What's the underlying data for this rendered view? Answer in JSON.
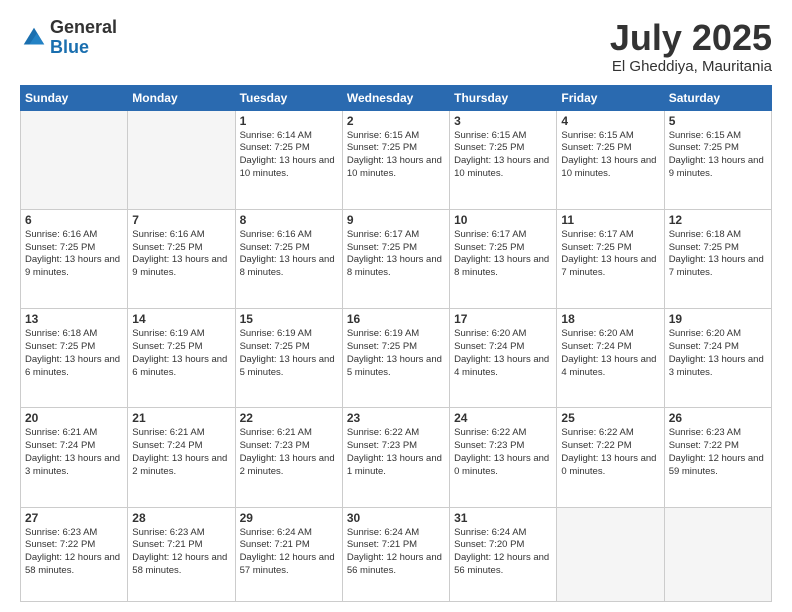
{
  "header": {
    "logo_line1": "General",
    "logo_line2": "Blue",
    "month": "July 2025",
    "location": "El Gheddiya, Mauritania"
  },
  "days_of_week": [
    "Sunday",
    "Monday",
    "Tuesday",
    "Wednesday",
    "Thursday",
    "Friday",
    "Saturday"
  ],
  "weeks": [
    [
      {
        "day": "",
        "info": ""
      },
      {
        "day": "",
        "info": ""
      },
      {
        "day": "1",
        "info": "Sunrise: 6:14 AM\nSunset: 7:25 PM\nDaylight: 13 hours\nand 10 minutes."
      },
      {
        "day": "2",
        "info": "Sunrise: 6:15 AM\nSunset: 7:25 PM\nDaylight: 13 hours\nand 10 minutes."
      },
      {
        "day": "3",
        "info": "Sunrise: 6:15 AM\nSunset: 7:25 PM\nDaylight: 13 hours\nand 10 minutes."
      },
      {
        "day": "4",
        "info": "Sunrise: 6:15 AM\nSunset: 7:25 PM\nDaylight: 13 hours\nand 10 minutes."
      },
      {
        "day": "5",
        "info": "Sunrise: 6:15 AM\nSunset: 7:25 PM\nDaylight: 13 hours\nand 9 minutes."
      }
    ],
    [
      {
        "day": "6",
        "info": "Sunrise: 6:16 AM\nSunset: 7:25 PM\nDaylight: 13 hours\nand 9 minutes."
      },
      {
        "day": "7",
        "info": "Sunrise: 6:16 AM\nSunset: 7:25 PM\nDaylight: 13 hours\nand 9 minutes."
      },
      {
        "day": "8",
        "info": "Sunrise: 6:16 AM\nSunset: 7:25 PM\nDaylight: 13 hours\nand 8 minutes."
      },
      {
        "day": "9",
        "info": "Sunrise: 6:17 AM\nSunset: 7:25 PM\nDaylight: 13 hours\nand 8 minutes."
      },
      {
        "day": "10",
        "info": "Sunrise: 6:17 AM\nSunset: 7:25 PM\nDaylight: 13 hours\nand 8 minutes."
      },
      {
        "day": "11",
        "info": "Sunrise: 6:17 AM\nSunset: 7:25 PM\nDaylight: 13 hours\nand 7 minutes."
      },
      {
        "day": "12",
        "info": "Sunrise: 6:18 AM\nSunset: 7:25 PM\nDaylight: 13 hours\nand 7 minutes."
      }
    ],
    [
      {
        "day": "13",
        "info": "Sunrise: 6:18 AM\nSunset: 7:25 PM\nDaylight: 13 hours\nand 6 minutes."
      },
      {
        "day": "14",
        "info": "Sunrise: 6:19 AM\nSunset: 7:25 PM\nDaylight: 13 hours\nand 6 minutes."
      },
      {
        "day": "15",
        "info": "Sunrise: 6:19 AM\nSunset: 7:25 PM\nDaylight: 13 hours\nand 5 minutes."
      },
      {
        "day": "16",
        "info": "Sunrise: 6:19 AM\nSunset: 7:25 PM\nDaylight: 13 hours\nand 5 minutes."
      },
      {
        "day": "17",
        "info": "Sunrise: 6:20 AM\nSunset: 7:24 PM\nDaylight: 13 hours\nand 4 minutes."
      },
      {
        "day": "18",
        "info": "Sunrise: 6:20 AM\nSunset: 7:24 PM\nDaylight: 13 hours\nand 4 minutes."
      },
      {
        "day": "19",
        "info": "Sunrise: 6:20 AM\nSunset: 7:24 PM\nDaylight: 13 hours\nand 3 minutes."
      }
    ],
    [
      {
        "day": "20",
        "info": "Sunrise: 6:21 AM\nSunset: 7:24 PM\nDaylight: 13 hours\nand 3 minutes."
      },
      {
        "day": "21",
        "info": "Sunrise: 6:21 AM\nSunset: 7:24 PM\nDaylight: 13 hours\nand 2 minutes."
      },
      {
        "day": "22",
        "info": "Sunrise: 6:21 AM\nSunset: 7:23 PM\nDaylight: 13 hours\nand 2 minutes."
      },
      {
        "day": "23",
        "info": "Sunrise: 6:22 AM\nSunset: 7:23 PM\nDaylight: 13 hours\nand 1 minute."
      },
      {
        "day": "24",
        "info": "Sunrise: 6:22 AM\nSunset: 7:23 PM\nDaylight: 13 hours\nand 0 minutes."
      },
      {
        "day": "25",
        "info": "Sunrise: 6:22 AM\nSunset: 7:22 PM\nDaylight: 13 hours\nand 0 minutes."
      },
      {
        "day": "26",
        "info": "Sunrise: 6:23 AM\nSunset: 7:22 PM\nDaylight: 12 hours\nand 59 minutes."
      }
    ],
    [
      {
        "day": "27",
        "info": "Sunrise: 6:23 AM\nSunset: 7:22 PM\nDaylight: 12 hours\nand 58 minutes."
      },
      {
        "day": "28",
        "info": "Sunrise: 6:23 AM\nSunset: 7:21 PM\nDaylight: 12 hours\nand 58 minutes."
      },
      {
        "day": "29",
        "info": "Sunrise: 6:24 AM\nSunset: 7:21 PM\nDaylight: 12 hours\nand 57 minutes."
      },
      {
        "day": "30",
        "info": "Sunrise: 6:24 AM\nSunset: 7:21 PM\nDaylight: 12 hours\nand 56 minutes."
      },
      {
        "day": "31",
        "info": "Sunrise: 6:24 AM\nSunset: 7:20 PM\nDaylight: 12 hours\nand 56 minutes."
      },
      {
        "day": "",
        "info": ""
      },
      {
        "day": "",
        "info": ""
      }
    ]
  ]
}
